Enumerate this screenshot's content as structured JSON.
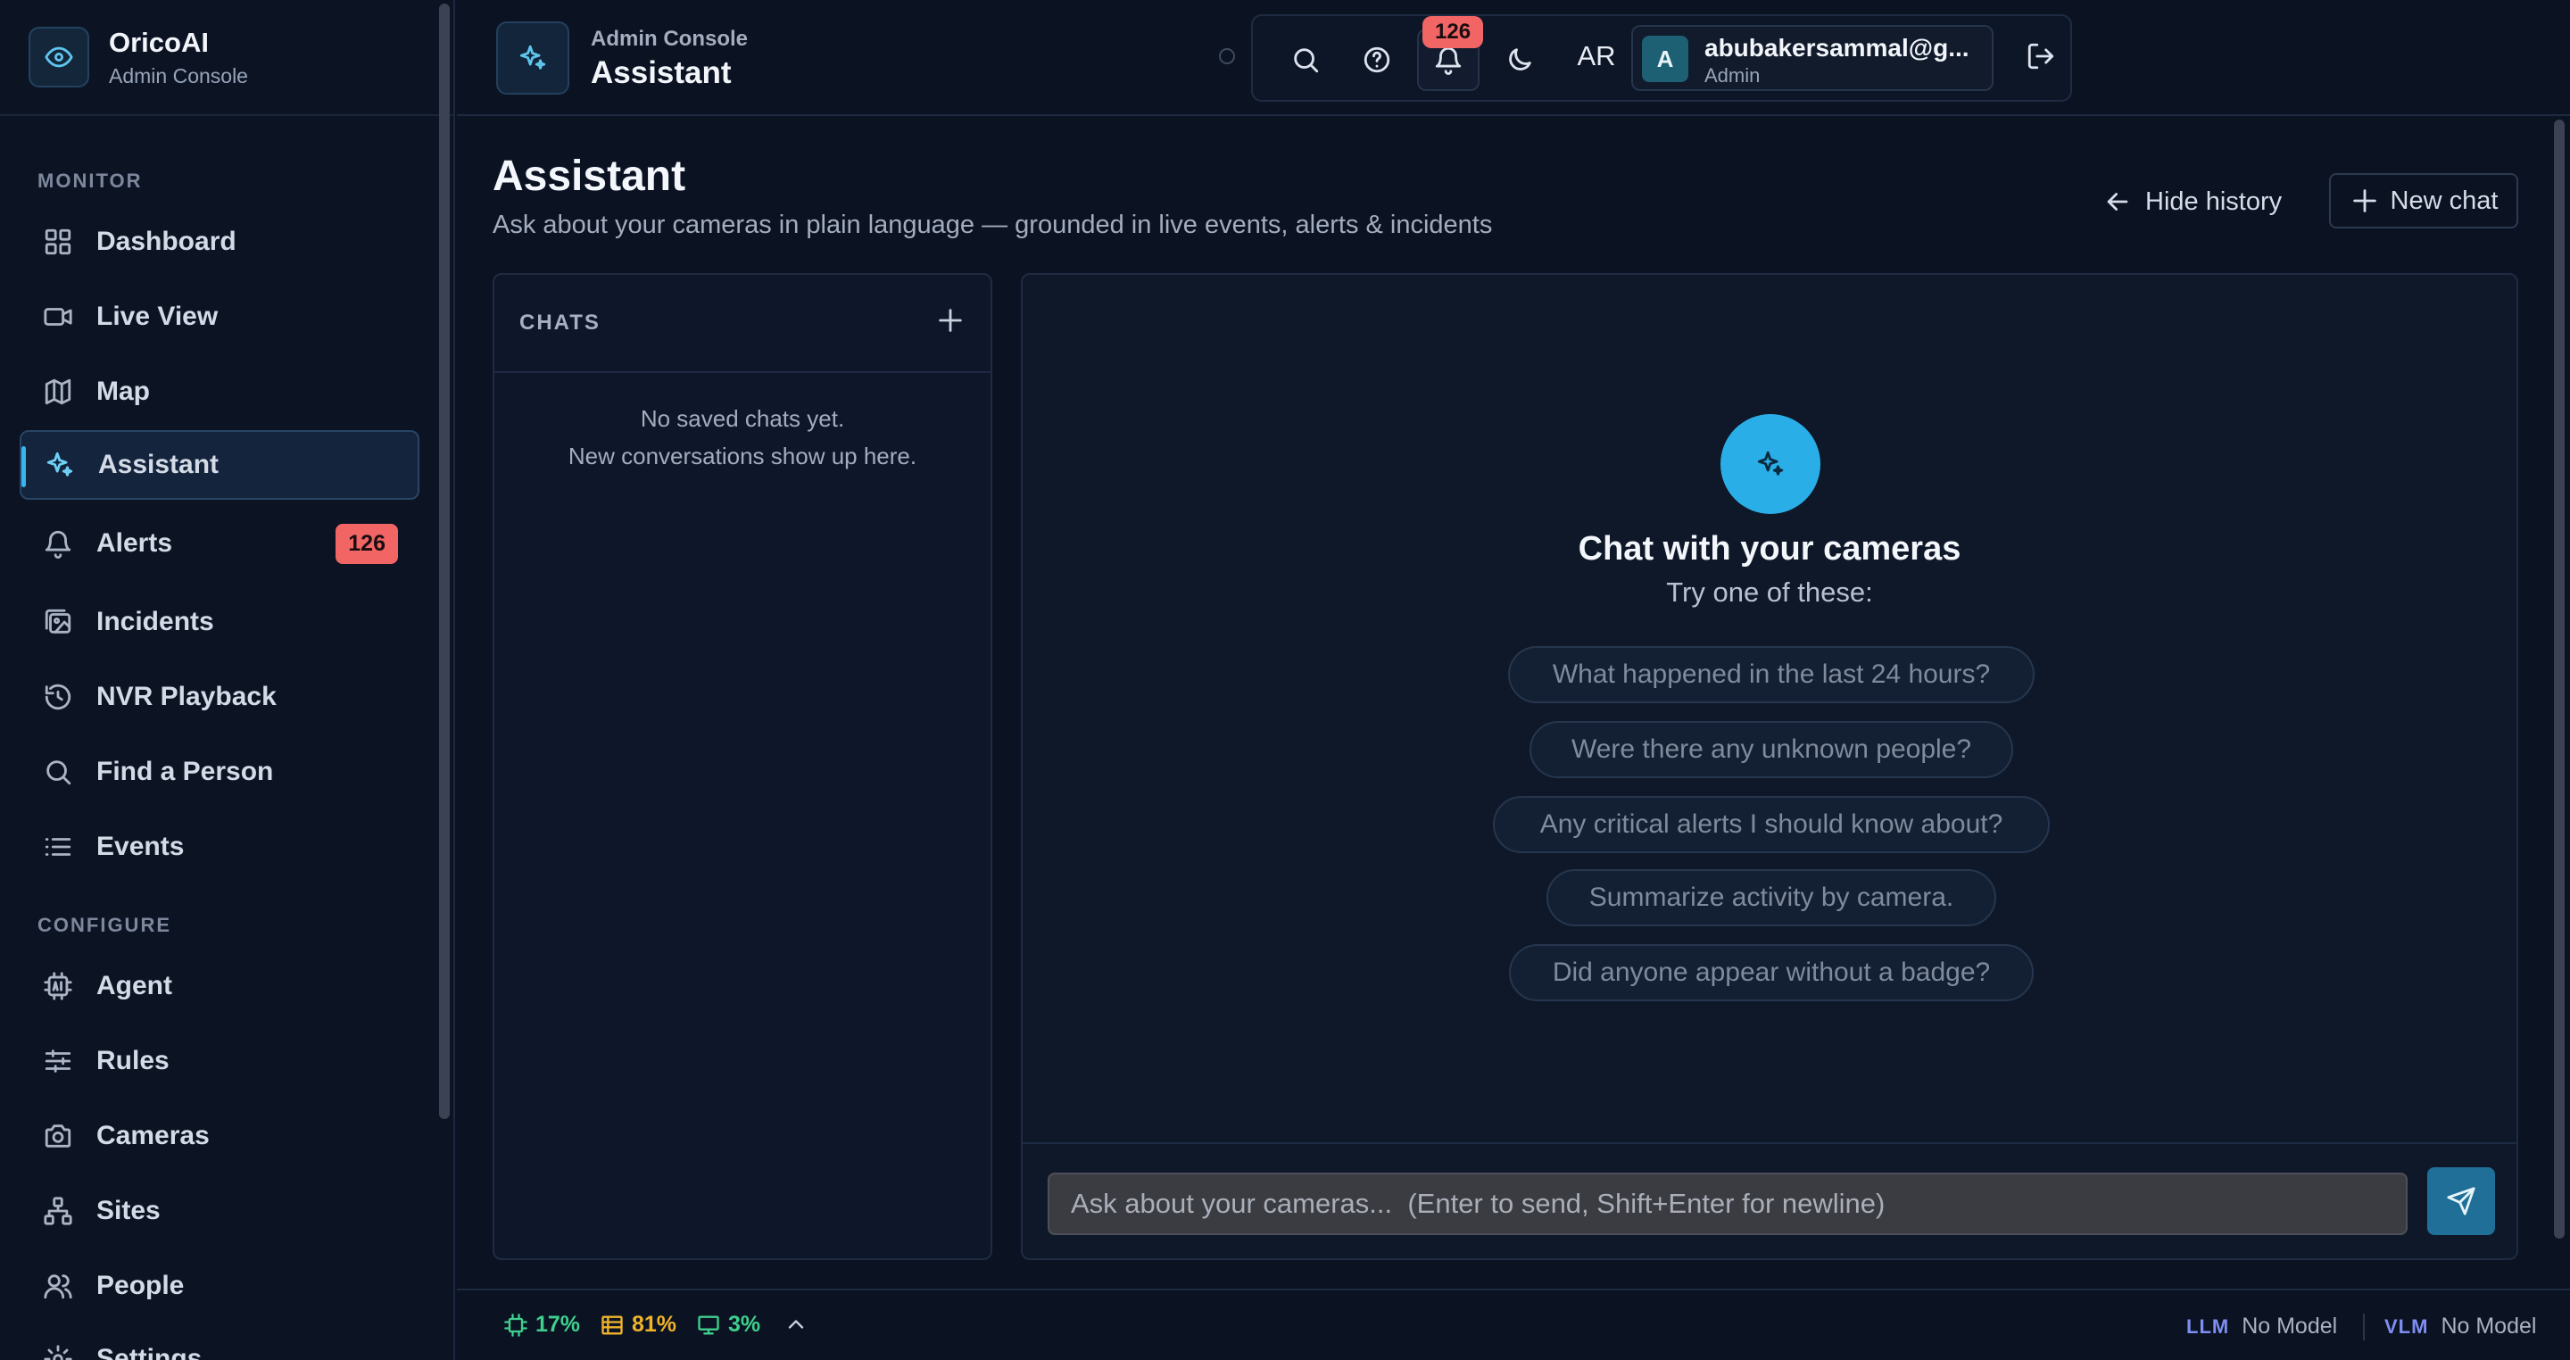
{
  "brand": {
    "name": "OricoAI",
    "subtitle": "Admin Console"
  },
  "sidebar": {
    "sections": {
      "monitor": "MONITOR",
      "configure": "CONFIGURE"
    },
    "items": [
      {
        "label": "Dashboard",
        "icon": "grid-icon"
      },
      {
        "label": "Live View",
        "icon": "video-icon"
      },
      {
        "label": "Map",
        "icon": "map-icon"
      },
      {
        "label": "Assistant",
        "icon": "sparkles-icon",
        "active": true
      },
      {
        "label": "Alerts",
        "icon": "bell-icon",
        "badge": "126"
      },
      {
        "label": "Incidents",
        "icon": "images-icon"
      },
      {
        "label": "NVR Playback",
        "icon": "history-icon"
      },
      {
        "label": "Find a Person",
        "icon": "search-icon"
      },
      {
        "label": "Events",
        "icon": "list-icon"
      },
      {
        "label": "Agent",
        "icon": "cpu-ai-icon"
      },
      {
        "label": "Rules",
        "icon": "sliders-icon"
      },
      {
        "label": "Cameras",
        "icon": "camera-icon"
      },
      {
        "label": "Sites",
        "icon": "network-icon"
      },
      {
        "label": "People",
        "icon": "users-icon"
      },
      {
        "label": "Settings",
        "icon": "gear-icon"
      }
    ]
  },
  "header": {
    "subtitle": "Admin Console",
    "title": "Assistant",
    "notifications_count": "126",
    "language": "AR",
    "user": {
      "initial": "A",
      "email": "abubakersammal@g...",
      "role": "Admin"
    }
  },
  "page": {
    "title": "Assistant",
    "subtitle": "Ask about your cameras in plain language — grounded in live events, alerts & incidents",
    "hide_history": "Hide history",
    "new_chat": "New chat"
  },
  "chats": {
    "label": "CHATS",
    "empty_line1": "No saved chats yet.",
    "empty_line2": "New conversations show up here."
  },
  "chat": {
    "title": "Chat with your cameras",
    "subtitle": "Try one of these:",
    "suggestions": [
      "What happened in the last 24 hours?",
      "Were there any unknown people?",
      "Any critical alerts I should know about?",
      "Summarize activity by camera.",
      "Did anyone appear without a badge?"
    ],
    "input_placeholder": "Ask about your cameras...  (Enter to send, Shift+Enter for newline)"
  },
  "status": {
    "cpu": "17%",
    "memory": "81%",
    "gpu": "3%",
    "llm_tag": "LLM",
    "llm_value": "No Model",
    "vlm_tag": "VLM",
    "vlm_value": "No Model"
  },
  "colors": {
    "accent": "#2aaee8",
    "badge": "#f16565",
    "cpu": "#3fd08e",
    "memory": "#f0b429",
    "gpu": "#3fd08e"
  }
}
